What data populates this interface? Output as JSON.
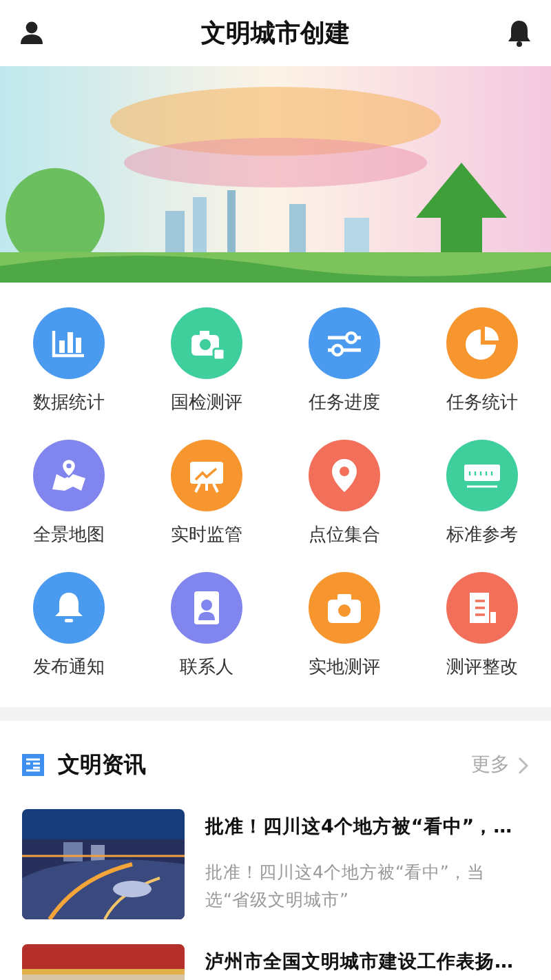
{
  "header": {
    "title": "文明城市创建"
  },
  "grid": [
    {
      "label": "数据统计",
      "kind": "chart",
      "color": "#4a9af0"
    },
    {
      "label": "国检测评",
      "kind": "camera-doc",
      "color": "#3fcf9c"
    },
    {
      "label": "任务进度",
      "kind": "sliders",
      "color": "#4a9af0"
    },
    {
      "label": "任务统计",
      "kind": "pie",
      "color": "#f7962e"
    },
    {
      "label": "全景地图",
      "kind": "map",
      "color": "#8186ee"
    },
    {
      "label": "实时监管",
      "kind": "board",
      "color": "#f7962e"
    },
    {
      "label": "点位集合",
      "kind": "pin",
      "color": "#f2705a"
    },
    {
      "label": "标准参考",
      "kind": "ruler",
      "color": "#3fcf9c"
    },
    {
      "label": "发布通知",
      "kind": "bell",
      "color": "#4a9af0"
    },
    {
      "label": "联系人",
      "kind": "contacts",
      "color": "#8186ee"
    },
    {
      "label": "实地测评",
      "kind": "camera",
      "color": "#f7962e"
    },
    {
      "label": "测评整改",
      "kind": "doc",
      "color": "#f2705a"
    }
  ],
  "news": {
    "title": "文明资讯",
    "more": "更多",
    "items": [
      {
        "title": "批准！四川这4个地方被“看中”，…",
        "summary": "批准！四川这4个地方被“看中”，当选“省级文明城市”",
        "kind": "picture"
      },
      {
        "title": "泸州市全国文明城市建设工作表扬…",
        "kind": "picture"
      }
    ]
  }
}
